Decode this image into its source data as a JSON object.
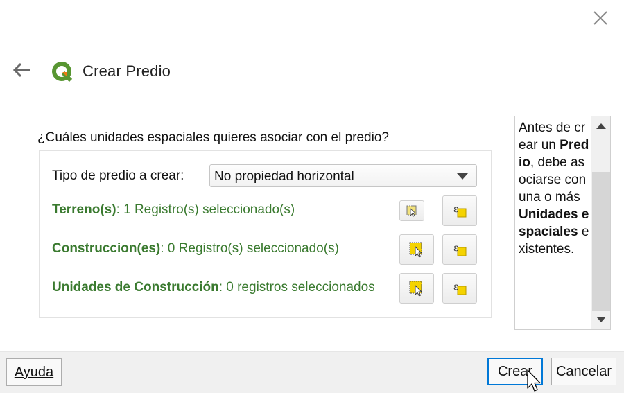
{
  "window": {
    "title": "Crear Predio",
    "close_icon": "close-icon",
    "back_icon": "back-arrow-icon",
    "logo_icon": "qgis-logo-icon"
  },
  "form": {
    "question": "¿Cuáles unidades espaciales quieres asociar con el predio?",
    "type_label": "Tipo de predio a crear:",
    "type_value": "No propiedad horizontal",
    "rows": [
      {
        "name": "Terreno(s)",
        "detail": ": 1 Registro(s) seleccionado(s)"
      },
      {
        "name": "Construccion(es)",
        "detail": ": 0 Registro(s) seleccionado(s)"
      },
      {
        "name": "Unidades de Construcción",
        "detail": ": 0 registros seleccionados"
      }
    ]
  },
  "help": {
    "t1": "Antes de crear un ",
    "b1": "Predio",
    "t2": ", debe asociarse con una o más ",
    "b2": "Unidades espaciales",
    "t3": " existentes."
  },
  "buttons": {
    "help": "Ayuda",
    "create": "Crear",
    "cancel": "Cancelar"
  },
  "colors": {
    "label_green": "#3a7a2f",
    "qgis_green": "#589632",
    "qgis_yellow": "#ee7913",
    "accent_blue": "#0078d7"
  }
}
